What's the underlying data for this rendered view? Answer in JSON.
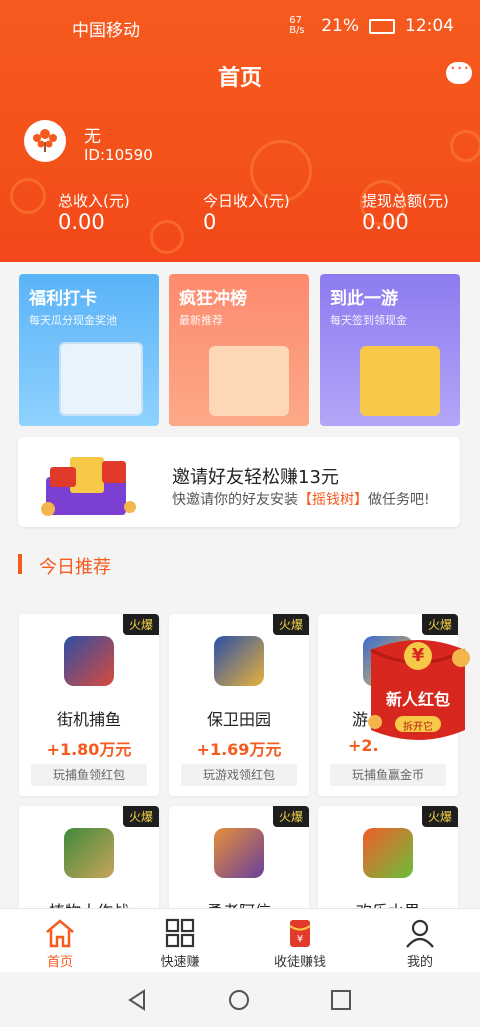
{
  "status": {
    "carrier": "中国移动",
    "net_speed": "67 B/s",
    "battery": "21%",
    "time": "12:04"
  },
  "header": {
    "title": "首页",
    "username": "无",
    "user_id": "ID:10590"
  },
  "stats": [
    {
      "label": "总收入(元)",
      "value": "0.00"
    },
    {
      "label": "今日收入(元)",
      "value": "0"
    },
    {
      "label": "提现总额(元)",
      "value": "0.00"
    }
  ],
  "cards": [
    {
      "title": "福利打卡",
      "subtitle": "每天瓜分现金奖池",
      "color": "#58b7f5"
    },
    {
      "title": "疯狂冲榜",
      "subtitle": "最新推荐",
      "color": "#fb8b79"
    },
    {
      "title": "到此一游",
      "subtitle": "每天签到领现金",
      "color": "#9a84ef"
    }
  ],
  "invite": {
    "title": "邀请好友轻松赚13元",
    "sub_pre": "快邀请你的好友安装",
    "sub_highlight": "【摇钱树】",
    "sub_post": "做任务吧!"
  },
  "section": {
    "title": "今日推荐"
  },
  "games": [
    {
      "name": "街机捕鱼",
      "prize": "+1.80万元",
      "tag": "玩捕鱼领红包",
      "hot": "火爆"
    },
    {
      "name": "保卫田园",
      "prize": "+1.69万元",
      "tag": "玩游戏领红包",
      "hot": "火爆"
    },
    {
      "name": "游",
      "prize": "+2.",
      "tag": "玩捕鱼赢金币",
      "hot": "火爆"
    },
    {
      "name": "植物大作战",
      "hot": "火爆"
    },
    {
      "name": "勇者阿信",
      "hot": "火爆"
    },
    {
      "name": "欢乐水果",
      "hot": "火爆"
    }
  ],
  "redpack": {
    "title": "新人红包",
    "button": "拆开它",
    "symbol": "¥"
  },
  "tabs": [
    {
      "label": "首页",
      "active": true
    },
    {
      "label": "快速赚",
      "active": false
    },
    {
      "label": "收徒赚钱",
      "active": false
    },
    {
      "label": "我的",
      "active": false
    }
  ],
  "colors": {
    "brand": "#f65a1e"
  }
}
